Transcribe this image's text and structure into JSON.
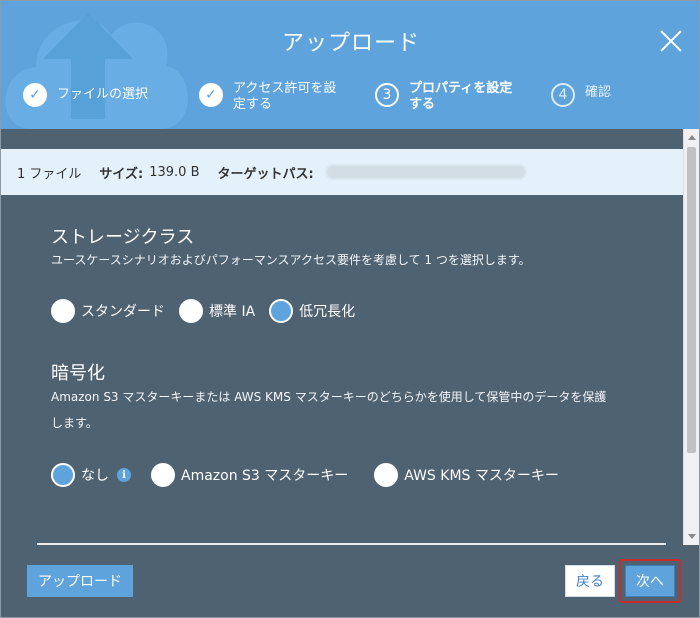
{
  "dialog": {
    "title": "アップロード"
  },
  "steps": [
    {
      "label": "ファイルの選択",
      "state": "done"
    },
    {
      "label_line1": "アクセス許可を設",
      "label_line2": "定する",
      "state": "done"
    },
    {
      "number": "3",
      "label_line1": "プロパティを設定",
      "label_line2": "する",
      "state": "current"
    },
    {
      "number": "4",
      "label": "確認",
      "state": "pending"
    }
  ],
  "info": {
    "file_count": "1 ファイル",
    "size_label": "サイズ:",
    "size_value": "139.0 B",
    "target_label": "ターゲットパス:"
  },
  "storage_class": {
    "title": "ストレージクラス",
    "description": "ユースケースシナリオおよびパフォーマンスアクセス要件を考慮して 1 つを選択します。",
    "options": [
      "スタンダード",
      "標準 IA",
      "低冗長化"
    ],
    "selected": "低冗長化"
  },
  "encryption": {
    "title": "暗号化",
    "description_line1": "Amazon S3 マスターキーまたは AWS KMS マスターキーのどちらかを使用して保管中のデータを保護",
    "description_line2": "します。",
    "options": [
      "なし",
      "Amazon S3 マスターキー",
      "AWS KMS マスターキー"
    ],
    "selected": "なし",
    "info_icon": "i"
  },
  "footer": {
    "upload_label": "アップロード",
    "back_label": "戻る",
    "next_label": "次へ"
  },
  "colors": {
    "header": "#5ea3dc",
    "body": "#4f6272",
    "infobar": "#e5f1fa",
    "accent": "#5ea3dc",
    "highlight": "#c72d2d"
  }
}
